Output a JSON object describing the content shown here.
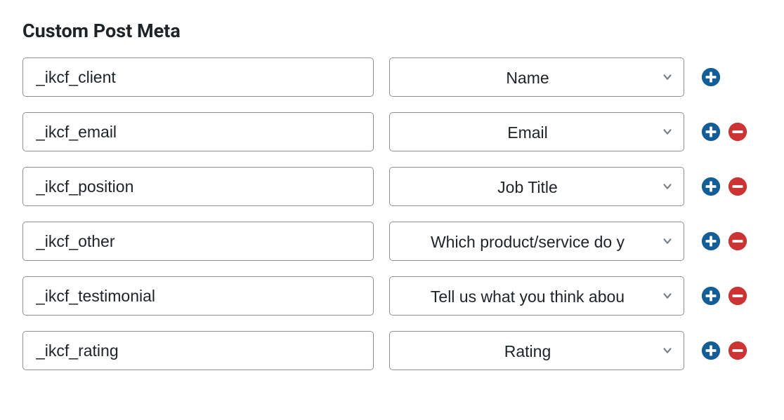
{
  "section": {
    "title": "Custom Post Meta"
  },
  "colors": {
    "add": "#135e96",
    "remove": "#cc3333",
    "border": "#8c8f94",
    "chevron": "#777f87"
  },
  "rows": [
    {
      "key": "_ikcf_client",
      "value": "Name",
      "canRemove": false
    },
    {
      "key": "_ikcf_email",
      "value": "Email",
      "canRemove": true
    },
    {
      "key": "_ikcf_position",
      "value": "Job Title",
      "canRemove": true
    },
    {
      "key": "_ikcf_other",
      "value": "Which product/service do y",
      "canRemove": true
    },
    {
      "key": "_ikcf_testimonial",
      "value": "Tell us what you think abou",
      "canRemove": true
    },
    {
      "key": "_ikcf_rating",
      "value": "Rating",
      "canRemove": true
    }
  ]
}
